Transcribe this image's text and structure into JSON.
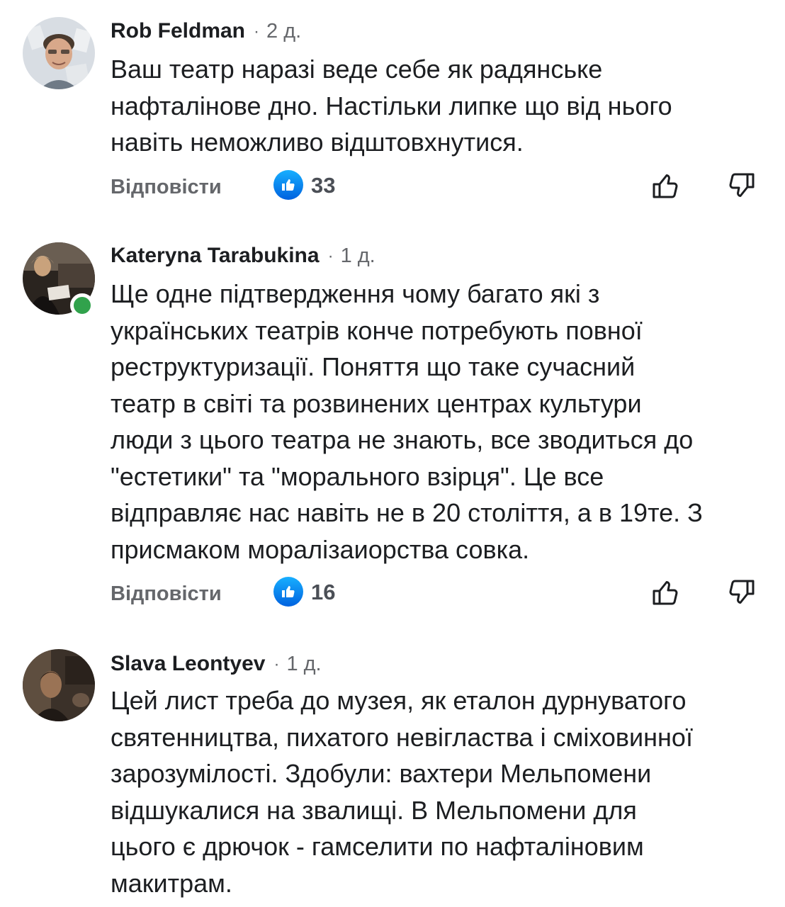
{
  "comments": [
    {
      "author": "Rob Feldman",
      "separator": "·",
      "time": "2 д.",
      "text": "Ваш театр наразі веде себе як радянське\nнафталінове дно. Настільки липке що від нього\nнавіть неможливо відштовхнутися.",
      "reply_label": "Відповісти",
      "likes": "33"
    },
    {
      "author": "Kateryna Tarabukina",
      "separator": "·",
      "time": "1 д.",
      "text": "Ще одне підтвердження чому багато які з\nукраїнських театрів конче потребують повної\nреструктуризації. Поняття що таке сучасний\nтеатр в світі та розвинених центрах культури\nлюди з цього театра не знають, все зводиться до\n\"естетики\" та \"морального взірця\". Це все\nвідправляє нас навіть не в 20 століття, а в 19те. З\nприсмаком моралізаиорства совка.",
      "reply_label": "Відповісти",
      "likes": "16"
    },
    {
      "author": "Slava Leontyev",
      "separator": "·",
      "time": "1 д.",
      "text": "Цей лист треба до музея, як еталон дурнуватого\nсвятенництва, пихатого невігластва і сміховинної\nзарозумілості. Здобули: вахтери Мельпомени\nвідшукалися на звалищі. В Мельпомени для\nцього є дрючок - гамселити по нафталіновим\nмакитрам."
    }
  ],
  "colors": {
    "text": "#1c1e21",
    "secondary": "#65676b",
    "like_blue": "#0866ff",
    "online_green": "#31a24c"
  },
  "icons": {
    "like_badge": "like-badge-icon",
    "thumb_up": "thumb-up-icon",
    "thumb_down": "thumb-down-icon"
  }
}
